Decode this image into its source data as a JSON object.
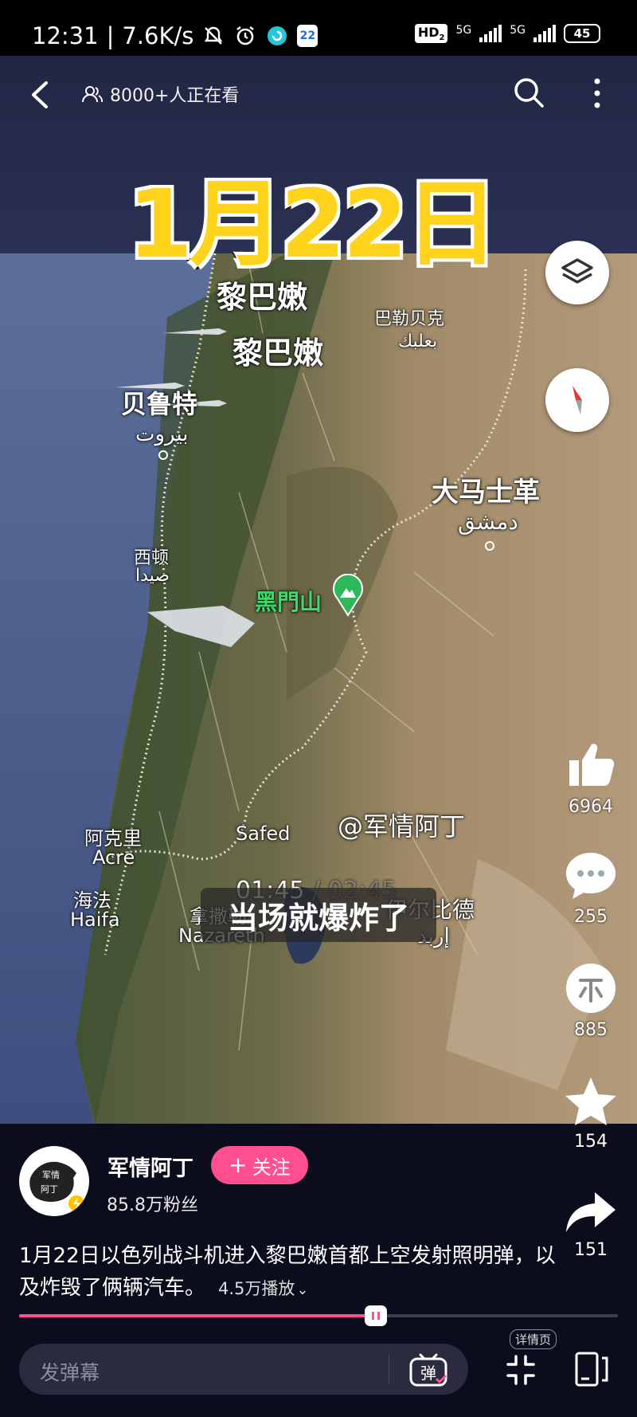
{
  "status_bar": {
    "time": "12:31",
    "speed": "7.6K/s",
    "calendar_day": "22",
    "hd_label": "HD",
    "hd_sub": "2",
    "net1": "5G",
    "net2": "5G",
    "battery": "45"
  },
  "top_nav": {
    "watchers": "8000+人正在看"
  },
  "video": {
    "date_title": "1月22日",
    "labels": {
      "lebanon1": "黎巴嫩",
      "lebanon2": "黎巴嫩",
      "baalbek": "巴勒贝克",
      "baalbek_ar": "بعلبك",
      "beirut": "贝鲁特",
      "beirut_ar": "بيروت",
      "damascus": "大马士革",
      "damascus_ar": "دمشق",
      "sidon": "西顿",
      "sidon_ar": "صيدا",
      "hermon": "黑門山",
      "acre_cn": "阿克里",
      "acre": "Acre",
      "safed": "Safed",
      "haifa_cn": "海法",
      "haifa": "Haifa",
      "nazareth_cn": "拿撒勒",
      "nazareth": "Nazareth",
      "irbid_cn": "伊尔比德",
      "irbid_ar": "إربد"
    },
    "watermark": "@军情阿丁",
    "time_current": "01:45",
    "time_sep": " / ",
    "time_total": "02:45",
    "subtitle": "当场就爆炸了",
    "progress_fraction": 0.596
  },
  "actions": {
    "likes": "6964",
    "comments": "255",
    "coins": "885",
    "favorites": "154",
    "shares": "151"
  },
  "author": {
    "name": "军情阿丁",
    "avatar_line1": "军情",
    "avatar_line2": "阿丁",
    "follow_label": "关注",
    "fans": "85.8万粉丝"
  },
  "description": {
    "text": "1月22日以色列战斗机进入黎巴嫩首都上空发射照明弹，以及炸毁了俩辆汽车。",
    "views": "4.5万播放"
  },
  "bottom_bar": {
    "danmu_placeholder": "发弹幕",
    "danmu_button": "弹",
    "detail_tag": "详情页"
  }
}
